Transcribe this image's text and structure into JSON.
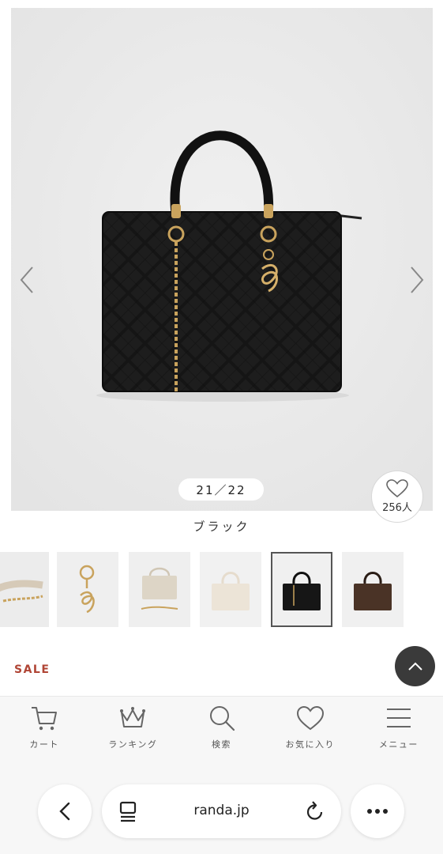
{
  "gallery": {
    "counter": "21／22",
    "favorite_count": "256人",
    "color_name": "ブラック",
    "prev_icon": "chevron-left-icon",
    "next_icon": "chevron-right-icon"
  },
  "thumbnails": [
    {
      "name": "beige strap",
      "selected": false
    },
    {
      "name": "gold charm",
      "selected": false
    },
    {
      "name": "beige bag with strap",
      "selected": false
    },
    {
      "name": "ivory bag",
      "selected": false
    },
    {
      "name": "black bag",
      "selected": true
    },
    {
      "name": "brown bag",
      "selected": false
    }
  ],
  "sale_label": "SALE",
  "tabbar": {
    "items": [
      {
        "label": "カート",
        "icon": "cart-icon"
      },
      {
        "label": "ランキング",
        "icon": "crown-icon"
      },
      {
        "label": "検索",
        "icon": "search-icon"
      },
      {
        "label": "お気に入り",
        "icon": "heart-icon"
      },
      {
        "label": "メニュー",
        "icon": "menu-icon"
      }
    ]
  },
  "browser": {
    "url": "randa.jp"
  },
  "colors": {
    "sale": "#b04535",
    "scroll_top_bg": "#3a3a3a",
    "bag": "#141414",
    "gold": "#c9a35d"
  }
}
